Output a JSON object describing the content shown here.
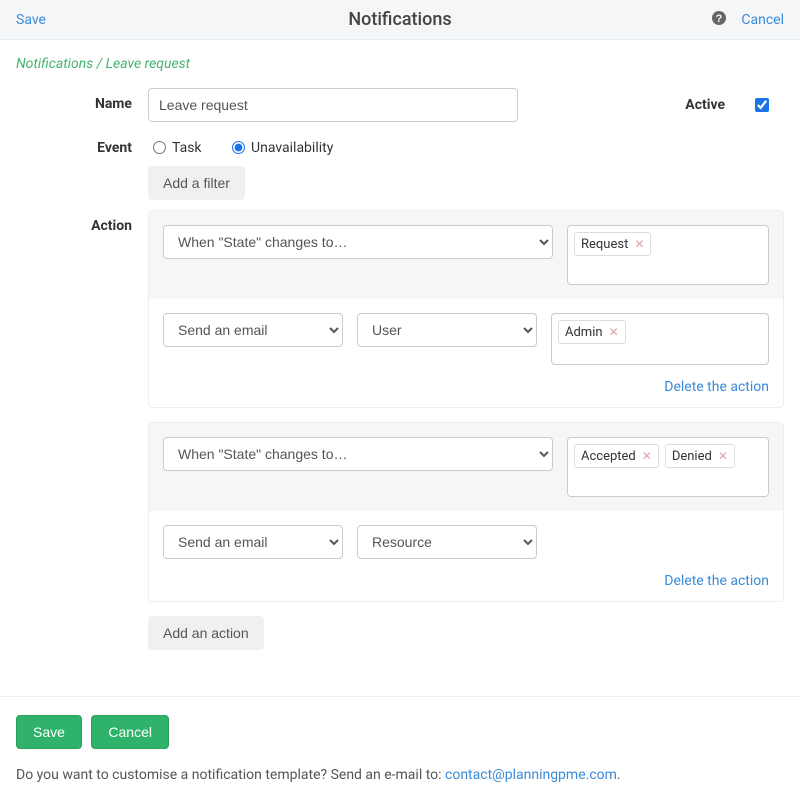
{
  "header": {
    "save": "Save",
    "title": "Notifications",
    "cancel": "Cancel"
  },
  "breadcrumb": "Notifications / Leave request",
  "labels": {
    "name": "Name",
    "active": "Active",
    "event": "Event",
    "action": "Action"
  },
  "form": {
    "name_value": "Leave request",
    "active_checked": true,
    "event_task": "Task",
    "event_unavail": "Unavailability",
    "event_selected": "unavailability"
  },
  "buttons": {
    "add_filter": "Add a filter",
    "add_action": "Add an action",
    "save": "Save",
    "cancel": "Cancel"
  },
  "actions": [
    {
      "trigger": "When \"State\" changes to…",
      "trigger_tags": [
        "Request"
      ],
      "do": "Send an email",
      "target": "User",
      "target_tags": [
        "Admin"
      ],
      "delete": "Delete the action"
    },
    {
      "trigger": "When \"State\" changes to…",
      "trigger_tags": [
        "Accepted",
        "Denied"
      ],
      "do": "Send an email",
      "target": "Resource",
      "target_tags": [],
      "delete": "Delete the action"
    }
  ],
  "footer": {
    "text": "Do you want to customise a notification template? Send an e-mail to: ",
    "email": "contact@planningpme.com"
  }
}
